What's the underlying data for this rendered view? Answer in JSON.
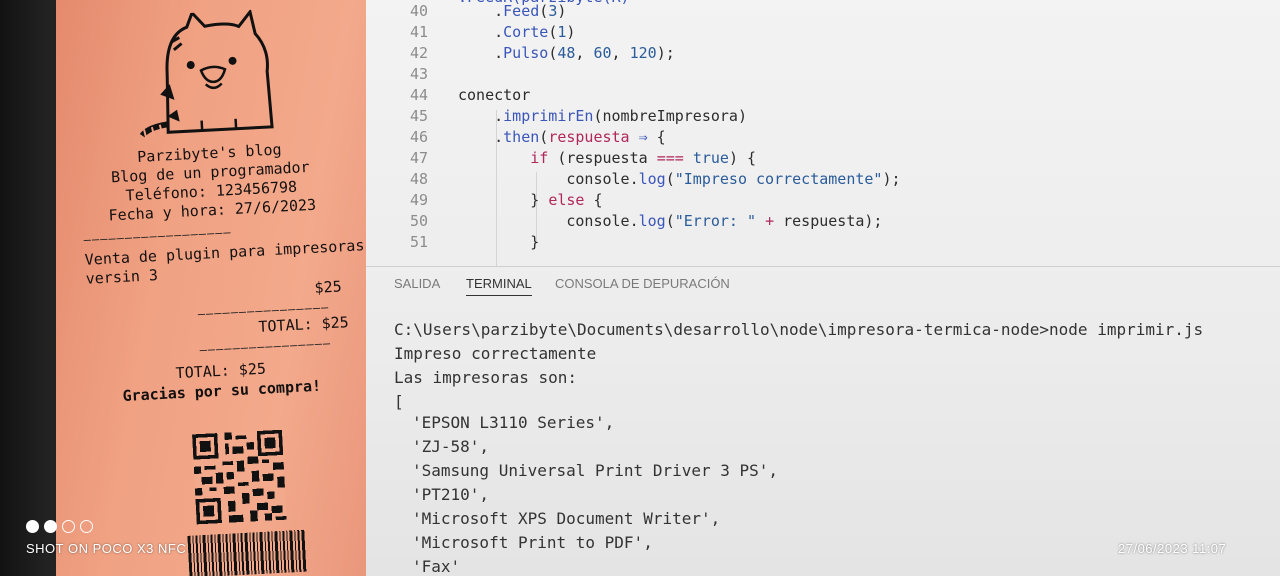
{
  "receipt": {
    "lines": {
      "title": "Parzibyte's blog",
      "subtitle": "Blog de un programador",
      "phone": "Teléfono: 123456798",
      "datetime": "Fecha y hora: 27/6/2023",
      "item_desc_1": "Venta de plugin para impresoras",
      "item_desc_2": "versin 3",
      "item_price": "$25",
      "total_right": "TOTAL: $25",
      "total_center": "TOTAL: $25",
      "thanks": "Gracias por su compra!"
    },
    "mascot_icon": "cat-icon",
    "qr_icon": "qr-code-icon",
    "barcode_icon": "barcode-icon"
  },
  "editor": {
    "lines": [
      {
        "num": "40",
        "code": "    .Feed(3)"
      },
      {
        "num": "41",
        "code": "    .Corte(1)"
      },
      {
        "num": "42",
        "code": "    .Pulso(48, 60, 120);"
      },
      {
        "num": "43",
        "code": ""
      },
      {
        "num": "44",
        "code": "conector"
      },
      {
        "num": "45",
        "code": "    .imprimirEn(nombreImpresora)"
      },
      {
        "num": "46",
        "code": "    .then(respuesta ⇒ {"
      },
      {
        "num": "47",
        "code": "        if (respuesta === true) {"
      },
      {
        "num": "48",
        "code": "            console.log(\"Impreso correctamente\");"
      },
      {
        "num": "49",
        "code": "        } else {"
      },
      {
        "num": "50",
        "code": "            console.log(\"Error: \" + respuesta);"
      },
      {
        "num": "51",
        "code": "        }"
      }
    ]
  },
  "panel": {
    "tabs": [
      {
        "label": "SALIDA"
      },
      {
        "label": "TERMINAL"
      },
      {
        "label": "CONSOLA DE DEPURACIÓN"
      }
    ],
    "active_tab": "TERMINAL"
  },
  "terminal": {
    "command": "C:\\Users\\parzibyte\\Documents\\desarrollo\\node\\impresora-termica-node>node imprimir.js",
    "out1": "Impreso correctamente",
    "out2": "Las impresoras son:",
    "open_bracket": "[",
    "printers": [
      "'EPSON L3110 Series',",
      "'ZJ-58',",
      "'Samsung Universal Print Driver 3 PS',",
      "'PT210',",
      "'Microsoft XPS Document Writer',",
      "'Microsoft Print to PDF',",
      "'Fax'"
    ]
  },
  "camera": {
    "watermark": "SHOT ON POCO X3 NFC",
    "timestamp": "27/06/2023  11:07"
  }
}
